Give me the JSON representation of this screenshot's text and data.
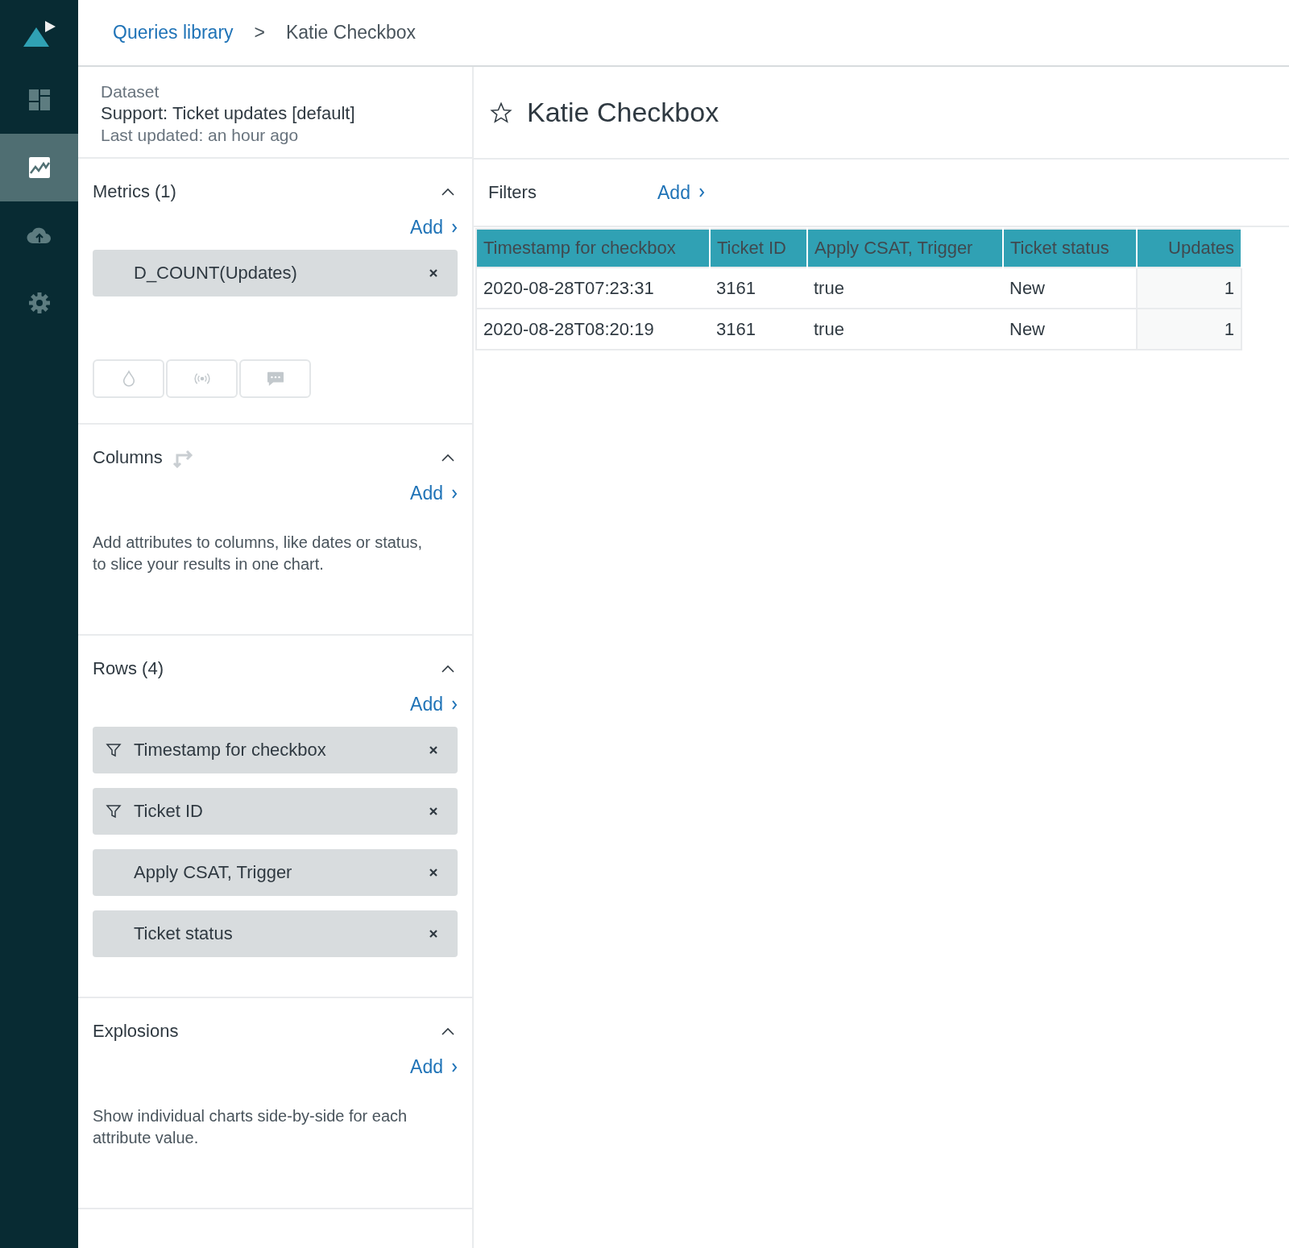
{
  "nav": [
    {
      "kind": "dashboard",
      "selected": false
    },
    {
      "kind": "reports",
      "selected": true
    },
    {
      "kind": "upload",
      "selected": false
    },
    {
      "kind": "settings",
      "selected": false
    }
  ],
  "breadcrumb": {
    "link": "Queries library",
    "separator": ">",
    "current": "Katie Checkbox"
  },
  "dataset": {
    "label": "Dataset",
    "name": "Support: Ticket updates [default]",
    "updated": "Last updated: an hour ago"
  },
  "sections": [
    {
      "kind": "metrics",
      "title": "Metrics (1)",
      "add": "Add",
      "items": [
        {
          "label": "D_COUNT(Updates)",
          "filtered": false
        }
      ]
    },
    {
      "kind": "columns",
      "title": "Columns",
      "add": "Add",
      "description": "Add attributes to columns, like dates or status, to slice your results in one chart."
    },
    {
      "kind": "rows",
      "title": "Rows (4)",
      "add": "Add",
      "items": [
        {
          "label": "Timestamp for checkbox",
          "filtered": true
        },
        {
          "label": "Ticket ID",
          "filtered": true
        },
        {
          "label": "Apply CSAT, Trigger",
          "filtered": false
        },
        {
          "label": "Ticket status",
          "filtered": false
        }
      ]
    },
    {
      "kind": "explosions",
      "title": "Explosions",
      "add": "Add",
      "description": "Show individual charts side-by-side for each attribute value."
    }
  ],
  "query": {
    "title": "Katie Checkbox",
    "starred": false
  },
  "filters": {
    "label": "Filters",
    "add": "Add"
  },
  "table": {
    "columns": [
      "Timestamp for checkbox",
      "Ticket ID",
      "Apply CSAT, Trigger",
      "Ticket status",
      "Updates"
    ],
    "rows": [
      [
        "2020-08-28T07:23:31",
        "3161",
        "true",
        "New",
        "1"
      ],
      [
        "2020-08-28T08:20:19",
        "3161",
        "true",
        "New",
        "1"
      ]
    ]
  }
}
